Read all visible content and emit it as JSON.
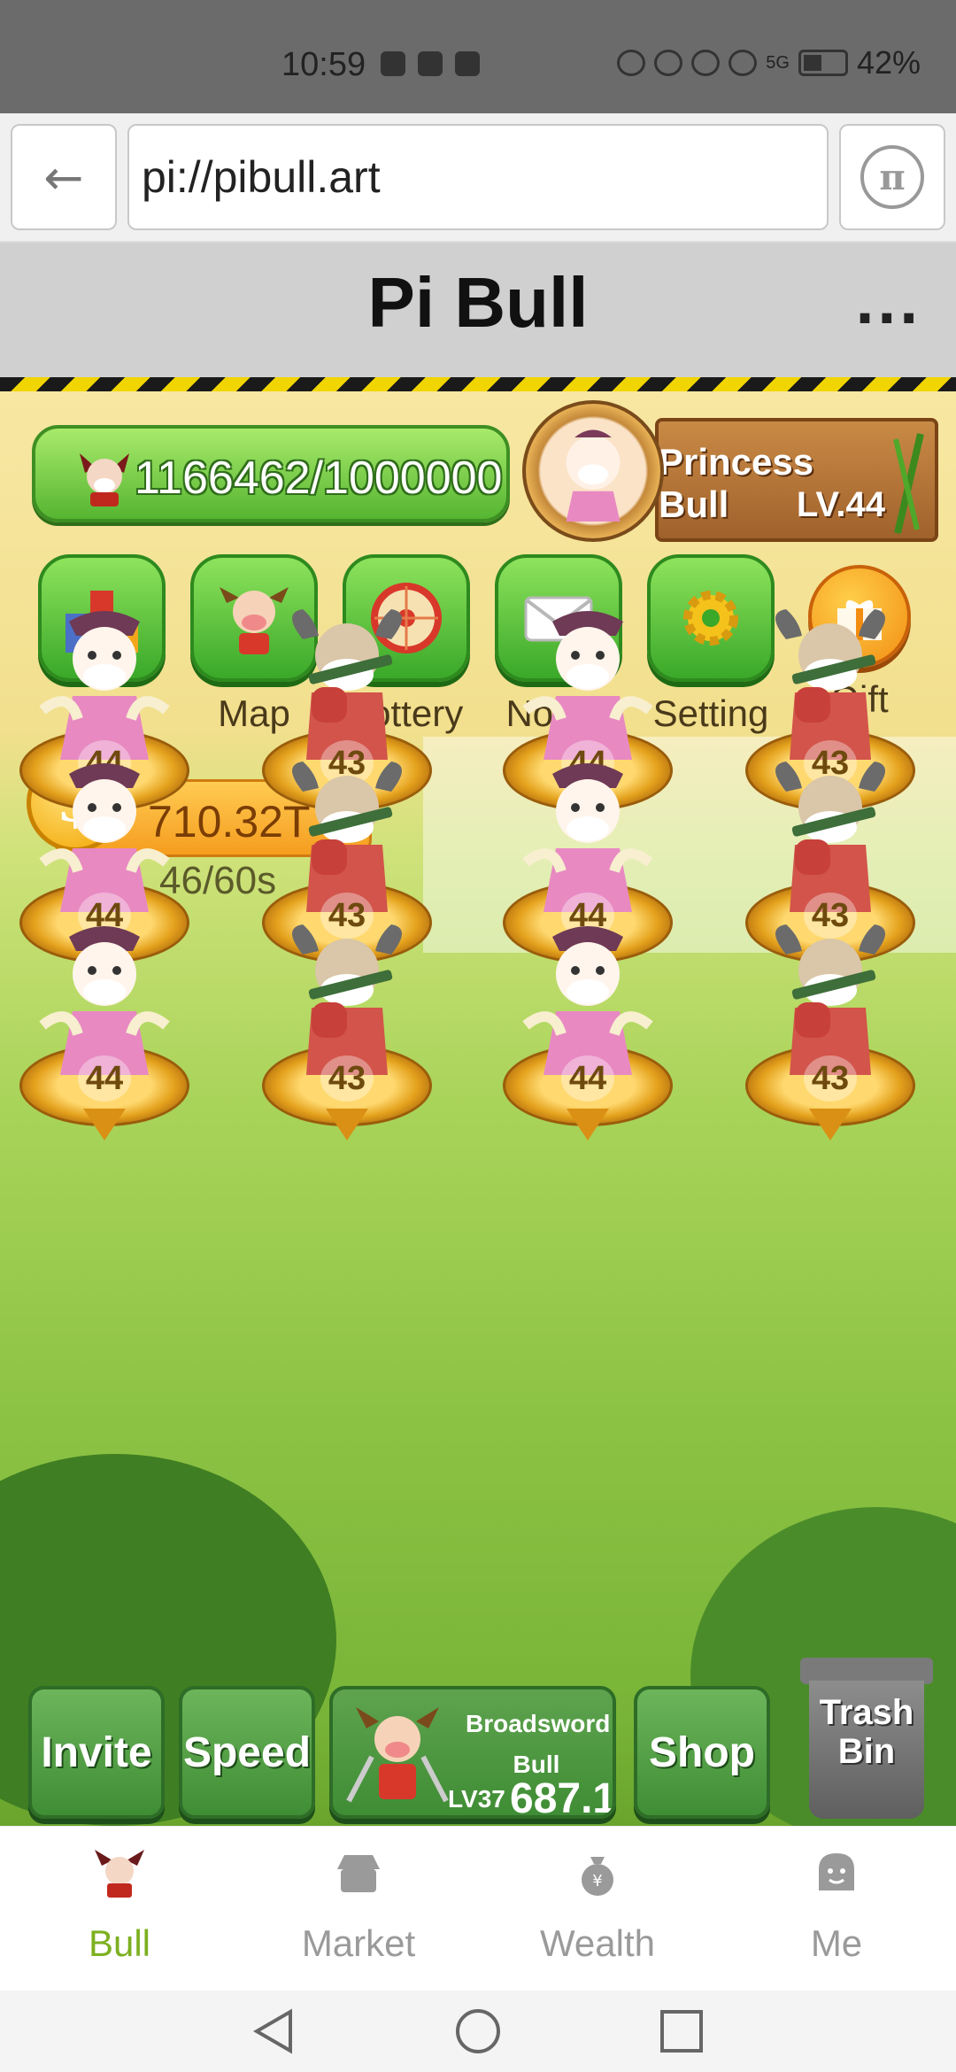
{
  "status_bar": {
    "time": "10:59",
    "battery": "42%",
    "network": "5G"
  },
  "browser": {
    "url": "pi://pibull.art"
  },
  "app": {
    "title": "Pi Bull",
    "more_label": "..."
  },
  "player": {
    "exp": "1166462/1000000",
    "name": "Princess Bull",
    "level": "LV.44"
  },
  "menu": {
    "top": "Top",
    "map": "Map",
    "lottery": "Lottery",
    "notice": "Notice",
    "setting": "Setting",
    "gift": "Gift"
  },
  "coins": {
    "amount": "710.32T",
    "timer": "46/60s"
  },
  "grid": [
    {
      "level": "44",
      "kind": "princess"
    },
    {
      "level": "43",
      "kind": "sword"
    },
    {
      "level": "44",
      "kind": "princess"
    },
    {
      "level": "43",
      "kind": "sword"
    },
    {
      "level": "44",
      "kind": "princess"
    },
    {
      "level": "43",
      "kind": "sword"
    },
    {
      "level": "44",
      "kind": "princess"
    },
    {
      "level": "43",
      "kind": "sword"
    },
    {
      "level": "44",
      "kind": "princess"
    },
    {
      "level": "43",
      "kind": "sword"
    },
    {
      "level": "44",
      "kind": "princess"
    },
    {
      "level": "43",
      "kind": "sword"
    }
  ],
  "actions": {
    "invite": "Invite",
    "speed": "Speed",
    "buy_bull_name_1": "Broadsword",
    "buy_bull_name_2": "Bull",
    "buy_bull_level": "LV37",
    "buy_bull_price": "687.1",
    "shop": "Shop",
    "trash_1": "Trash",
    "trash_2": "Bin"
  },
  "nav": {
    "bull": "Bull",
    "market": "Market",
    "wealth": "Wealth",
    "me": "Me"
  },
  "colors": {
    "accent_green": "#7cb020",
    "button_green": "#3aa829",
    "coin_orange": "#f59d1f"
  }
}
